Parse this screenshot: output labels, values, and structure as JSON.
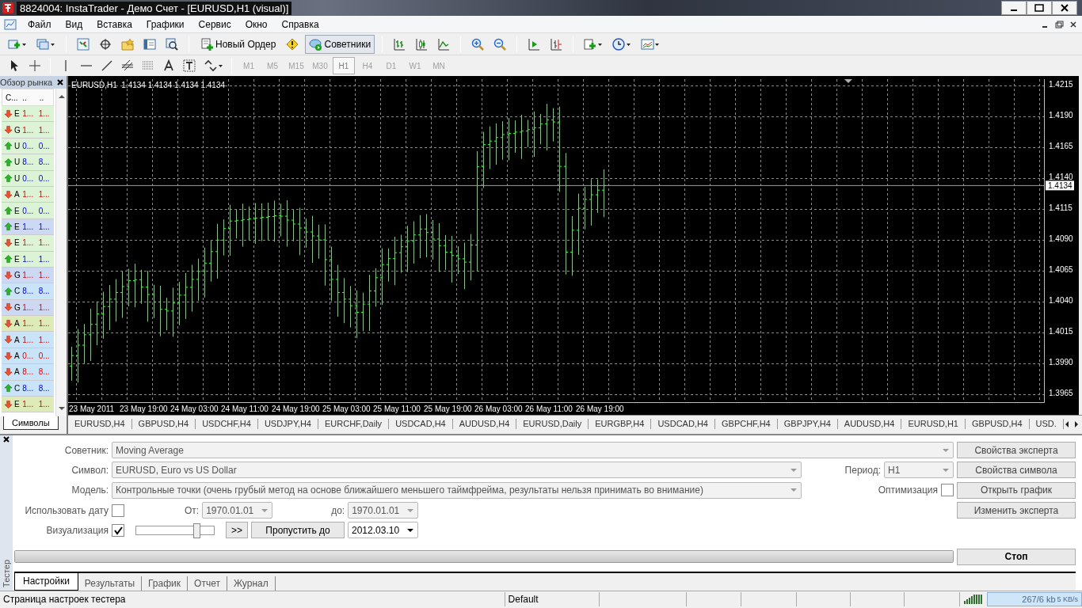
{
  "window": {
    "title": "8824004: InstaTrader - Демо Счет - [EURUSD,H1 (visual)]"
  },
  "menu": [
    "Файл",
    "Вид",
    "Вставка",
    "Графики",
    "Сервис",
    "Окно",
    "Справка"
  ],
  "toolbar": {
    "new_order": "Новый Ордер",
    "experts": {
      "label": "Советники",
      "selected": true
    }
  },
  "timeframes": [
    {
      "label": "M1",
      "selected": false
    },
    {
      "label": "M5",
      "selected": false
    },
    {
      "label": "M15",
      "selected": false
    },
    {
      "label": "M30",
      "selected": false
    },
    {
      "label": "H1",
      "selected": true
    },
    {
      "label": "H4",
      "selected": false
    },
    {
      "label": "D1",
      "selected": false
    },
    {
      "label": "W1",
      "selected": false
    },
    {
      "label": "MN",
      "selected": false
    }
  ],
  "market_watch": {
    "title": "Обзор рынка",
    "columns": [
      "С...",
      "..",
      ".."
    ],
    "rows": [
      {
        "symbol": "E",
        "bid": "1...",
        "ask": "1...",
        "kind": "down",
        "color": "#dcf3d6"
      },
      {
        "symbol": "G",
        "bid": "1...",
        "ask": "1...",
        "kind": "down",
        "color": "#dcf3d6"
      },
      {
        "symbol": "U",
        "bid": "0...",
        "ask": "0...",
        "kind": "up",
        "color": "#dcf3d6"
      },
      {
        "symbol": "U",
        "bid": "8...",
        "ask": "8...",
        "kind": "up",
        "color": "#dcf3d6"
      },
      {
        "symbol": "U",
        "bid": "0...",
        "ask": "0...",
        "kind": "up",
        "color": "#dcf3d6"
      },
      {
        "symbol": "A",
        "bid": "1...",
        "ask": "1...",
        "kind": "down",
        "color": "#dcf3d6"
      },
      {
        "symbol": "E",
        "bid": "0...",
        "ask": "0...",
        "kind": "up",
        "color": "#dcf3d6"
      },
      {
        "symbol": "E",
        "bid": "1...",
        "ask": "1...",
        "kind": "up",
        "color": "#cdd8f3"
      },
      {
        "symbol": "E",
        "bid": "1...",
        "ask": "1...",
        "kind": "down",
        "color": "#dcf3d6"
      },
      {
        "symbol": "E",
        "bid": "1...",
        "ask": "1...",
        "kind": "up",
        "color": "#dcf3d6"
      },
      {
        "symbol": "G",
        "bid": "1...",
        "ask": "1...",
        "kind": "down",
        "color": "#cdd8f3"
      },
      {
        "symbol": "C",
        "bid": "8...",
        "ask": "8...",
        "kind": "up",
        "color": "#c9e3f8"
      },
      {
        "symbol": "G",
        "bid": "1...",
        "ask": "1...",
        "kind": "down",
        "color": "#cdd8f3"
      },
      {
        "symbol": "A",
        "bid": "1...",
        "ask": "1...",
        "kind": "down",
        "color": "#dcebb8"
      },
      {
        "symbol": "A",
        "bid": "1...",
        "ask": "1...",
        "kind": "down",
        "color": "#c9e3f8"
      },
      {
        "symbol": "A",
        "bid": "0...",
        "ask": "0...",
        "kind": "down",
        "color": "#c9e3f8"
      },
      {
        "symbol": "A",
        "bid": "8...",
        "ask": "8...",
        "kind": "down",
        "color": "#c9e3f8"
      },
      {
        "symbol": "C",
        "bid": "8...",
        "ask": "8...",
        "kind": "up",
        "color": "#c9e3f8"
      },
      {
        "symbol": "E",
        "bid": "1...",
        "ask": "1...",
        "kind": "down",
        "color": "#dcebb8"
      }
    ],
    "tab": "Символы"
  },
  "chart": {
    "legend": "EURUSD,H1  1.4134 1.4134 1.4134 1.4134",
    "price_labels": [
      "1.4215",
      "1.4190",
      "1.4165",
      "1.4140",
      "1.4115",
      "1.4090",
      "1.4065",
      "1.4040",
      "1.4015",
      "1.3990",
      "1.3965"
    ],
    "current_price": "1.4134",
    "time_labels": [
      "23 May 2011",
      "23 May 19:00",
      "24 May 03:00",
      "24 May 11:00",
      "24 May 19:00",
      "25 May 03:00",
      "25 May 11:00",
      "25 May 19:00",
      "26 May 03:00",
      "26 May 11:00",
      "26 May 19:00"
    ]
  },
  "chart_tabs": [
    "EURUSD,H4",
    "GBPUSD,H4",
    "USDCHF,H4",
    "USDJPY,H4",
    "EURCHF,Daily",
    "USDCAD,H4",
    "AUDUSD,H4",
    "EURUSD,Daily",
    "EURGBP,H4",
    "USDCAD,H4",
    "GBPCHF,H4",
    "GBPJPY,H4",
    "AUDUSD,H4",
    "EURUSD,H1",
    "GBPUSD,H4",
    "USD."
  ],
  "tester": {
    "side_label": "Тестер",
    "expert": {
      "label": "Советник:",
      "value": "Moving Average",
      "disabled": true
    },
    "symbol": {
      "label": "Символ:",
      "value": "EURUSD, Euro vs US Dollar",
      "disabled": true
    },
    "period": {
      "label": "Период:",
      "value": "H1",
      "disabled": true
    },
    "model": {
      "label": "Модель:",
      "value": "Контрольные точки (очень грубый метод на основе ближайшего меньшего таймфрейма, результаты нельзя принимать во внимание)",
      "disabled": true
    },
    "optimization": {
      "label": "Оптимизация",
      "checked": false
    },
    "use_date": {
      "label": "Использовать дату",
      "checked": false
    },
    "from": {
      "label": "От:",
      "value": "1970.01.01",
      "disabled": true
    },
    "to": {
      "label": "до:",
      "value": "1970.01.01",
      "disabled": true
    },
    "visualization": {
      "label": "Визуализация",
      "checked": true
    },
    "speed": {
      "level": 0.8
    },
    "skip_button": ">>",
    "skip_to_button": "Пропустить до",
    "skip_date": {
      "value": "2012.03.10",
      "disabled": false
    },
    "buttons": [
      "Свойства эксперта",
      "Свойства символа",
      "Открыть график",
      "Изменить эксперта"
    ],
    "progress": {
      "level": 1
    },
    "stop_button": "Стоп",
    "tabs": [
      {
        "label": "Настройки",
        "selected": true
      },
      {
        "label": "Результаты",
        "selected": false
      },
      {
        "label": "График",
        "selected": false
      },
      {
        "label": "Отчет",
        "selected": false
      },
      {
        "label": "Журнал",
        "selected": false
      }
    ]
  },
  "status_bar": {
    "message": "Страница настроек тестера",
    "profile": "Default",
    "traffic": "267/6 kb",
    "speed": "5 KB/s"
  }
}
